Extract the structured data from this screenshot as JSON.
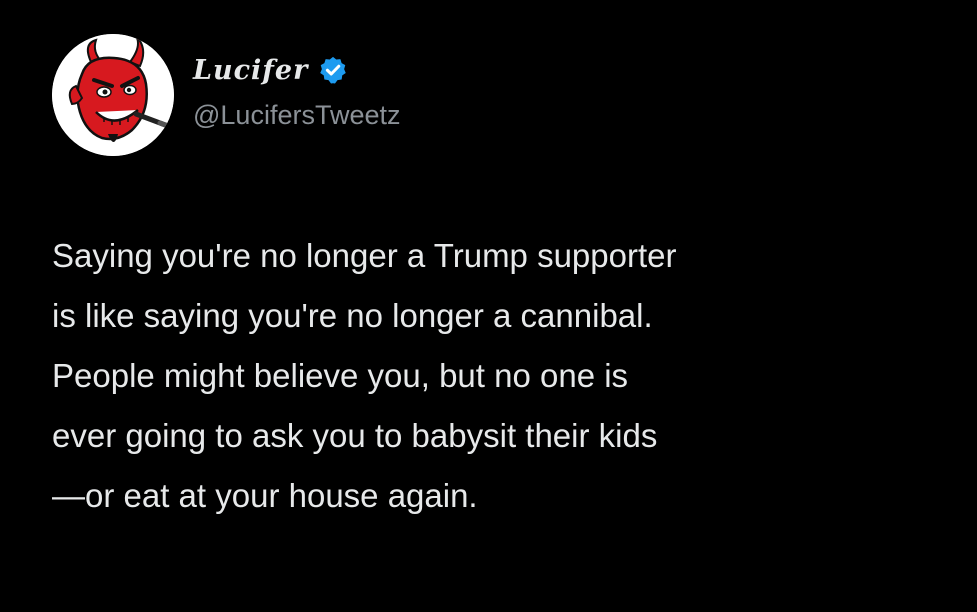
{
  "author": {
    "display_name": "Lucifer",
    "handle": "@LucifersTweetz",
    "verified": true,
    "avatar_icon": "devil-avatar-icon",
    "verified_icon": "verified-badge-icon"
  },
  "tweet": {
    "lines": [
      "Saying you're no longer a Trump supporter",
      "is like saying you're no longer a cannibal.",
      "People might believe you, but no one is",
      "ever going to ask you to babysit their kids",
      "—or eat at your house again."
    ]
  },
  "colors": {
    "background": "#000000",
    "text": "#e7e9ea",
    "secondary": "#8b9197",
    "verified": "#1d9bf0",
    "avatar_red": "#d7191f"
  }
}
